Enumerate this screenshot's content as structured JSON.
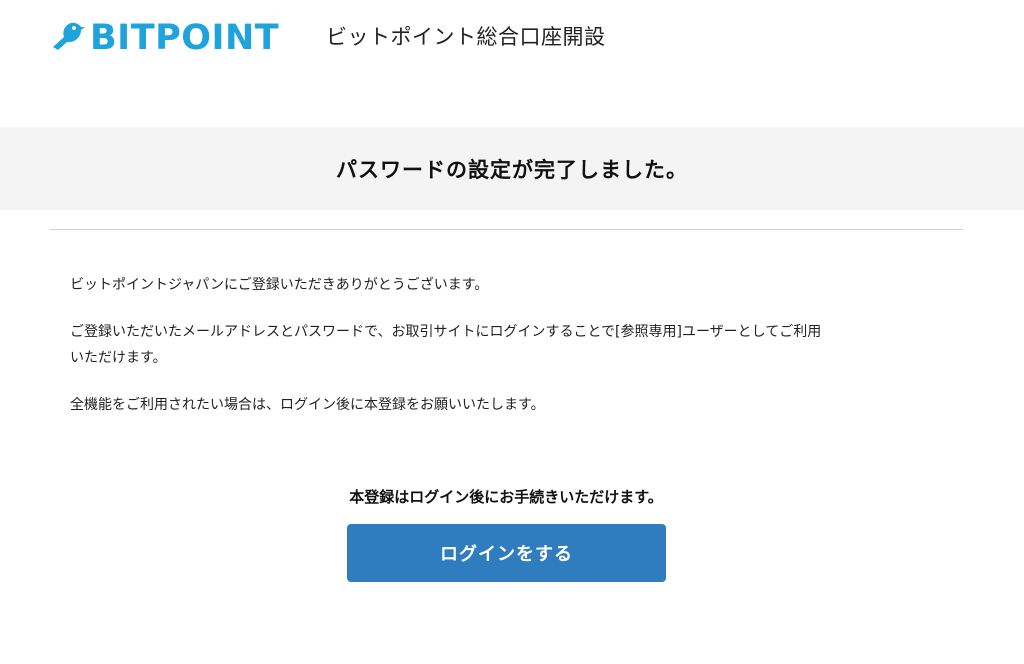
{
  "header": {
    "logo_text": "BITPOINT",
    "logo_icon": "bird-icon",
    "site_title": "ビットポイント総合口座開設"
  },
  "banner": {
    "title": "パスワードの設定が完了しました。"
  },
  "content": {
    "paragraph_1": "ビットポイントジャパンにご登録いただきありがとうございます。",
    "paragraph_2_line_1": "ご登録いただいたメールアドレスとパスワードで、お取引サイトにログインすることで[参照専用]ユーザーとしてご利用",
    "paragraph_2_line_2": "いただけます。",
    "paragraph_3": "全機能をご利用されたい場合は、ログイン後に本登録をお願いいたします。"
  },
  "action": {
    "notice": "本登録はログイン後にお手続きいただけます。",
    "login_button": "ログインをする"
  },
  "colors": {
    "brand": "#1fa3dd",
    "button": "#2f7dbf",
    "banner_bg": "#f4f4f4"
  }
}
